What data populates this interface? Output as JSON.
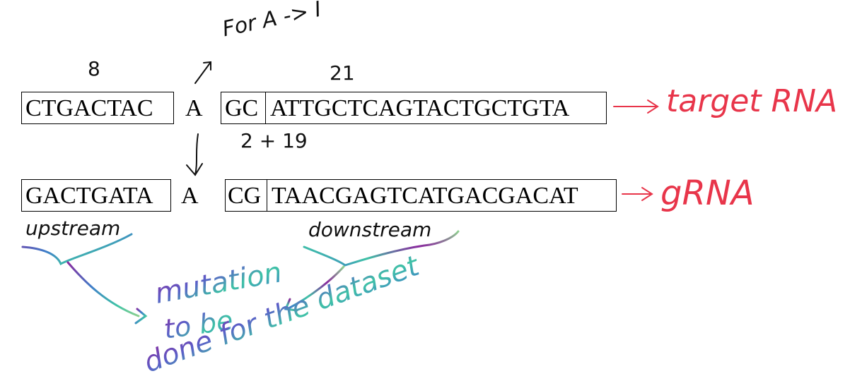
{
  "annotations": {
    "for_a_to_i": "For A -> I",
    "count_8": "8",
    "count_21": "21",
    "count_2_19": "2 + 19",
    "upstream": "upstream",
    "downstream": "downstream",
    "target_rna": "target RNA",
    "grna": "gRNA",
    "note_line1": "mutation",
    "note_line2": "to be",
    "note_line3": "done for the dataset"
  },
  "target_row": {
    "upstream_seq": "CTGACTAC",
    "site": "A",
    "pre_seq": "GC",
    "main_seq": "ATTGCTCAGTACTGCTGTA"
  },
  "grna_row": {
    "upstream_seq": "GACTGATA",
    "site": "A",
    "pre_seq": "CG",
    "main_seq": "TAACGAGTCATGACGACAT"
  },
  "colors": {
    "ink": "#111111",
    "red": "#e8354a",
    "gradient_purple": "#8a2a9e",
    "gradient_blue": "#3f7fc9",
    "gradient_teal": "#3fc3a6",
    "gradient_green": "#8ed08f"
  }
}
